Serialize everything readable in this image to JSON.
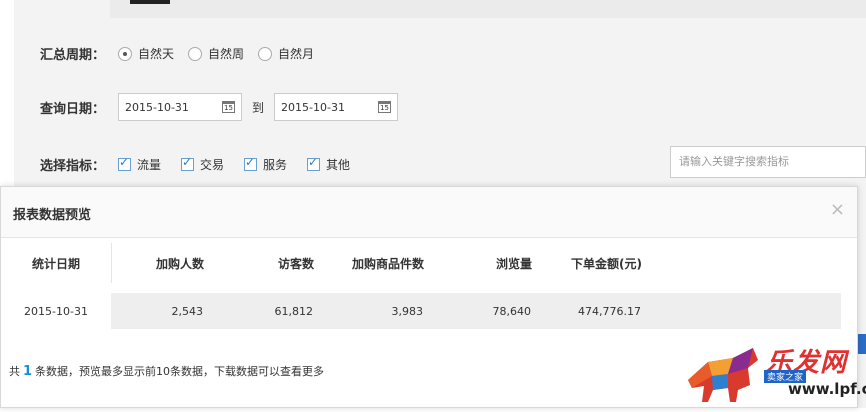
{
  "filters": {
    "period": {
      "label": "汇总周期：",
      "options": [
        {
          "label": "自然天",
          "selected": true
        },
        {
          "label": "自然周",
          "selected": false
        },
        {
          "label": "自然月",
          "selected": false
        }
      ]
    },
    "date": {
      "label": "查询日期：",
      "from": "2015-10-31",
      "to_label": "到",
      "to": "2015-10-31",
      "calendar_glyph": "15"
    },
    "metrics": {
      "label": "选择指标：",
      "options": [
        {
          "label": "流量",
          "checked": true
        },
        {
          "label": "交易",
          "checked": true
        },
        {
          "label": "服务",
          "checked": true
        },
        {
          "label": "其他",
          "checked": true
        }
      ]
    },
    "search_placeholder": "请输入关键字搜索指标"
  },
  "modal": {
    "title": "报表数据预览",
    "close_glyph": "×",
    "columns": [
      "统计日期",
      "加购人数",
      "访客数",
      "加购商品件数",
      "浏览量",
      "下单金额(元)"
    ],
    "rows": [
      [
        "2015-10-31",
        "2,543",
        "61,812",
        "3,983",
        "78,640",
        "474,776.17"
      ]
    ],
    "footer": {
      "prefix": "共",
      "count": "1",
      "suffix": "条数据，预览最多显示前10条数据，下载数据可以查看更多"
    }
  },
  "watermark": {
    "brand": "乐发网",
    "url": "www.lpf.cn",
    "sub": "卖家之家"
  },
  "colors": {
    "accent": "#1a8fd6",
    "check": "#2a7bc6",
    "watermark_red": "#e03030"
  }
}
